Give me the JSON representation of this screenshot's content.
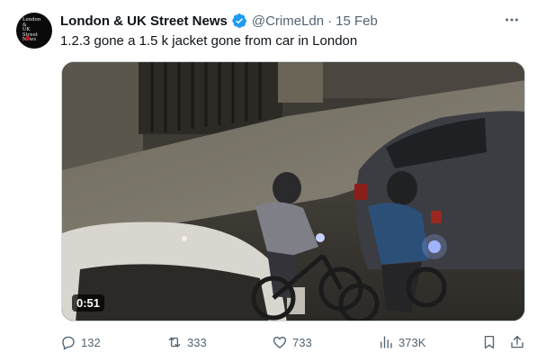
{
  "account": {
    "name": "London & UK Street News",
    "handle": "@CrimeLdn",
    "separator": "·",
    "date": "15 Feb",
    "verified": true,
    "verified_color": "#1d9bf0",
    "avatar_logo_lines": [
      "London &",
      "UK Street",
      "News"
    ]
  },
  "tweet": {
    "text": "1.2.3 gone a 1.5 k jacket gone from car in London"
  },
  "media": {
    "type": "video",
    "duration": "0:51"
  },
  "actions": {
    "replies": {
      "icon": "reply-icon",
      "count": "132"
    },
    "reposts": {
      "icon": "repost-icon",
      "count": "333"
    },
    "likes": {
      "icon": "like-icon",
      "count": "733"
    },
    "views": {
      "icon": "views-icon",
      "count": "373K"
    },
    "bookmark": {
      "icon": "bookmark-icon"
    },
    "share": {
      "icon": "share-icon"
    }
  },
  "colors": {
    "text_primary": "#0f1419",
    "text_secondary": "#536471",
    "accent": "#1d9bf0"
  }
}
